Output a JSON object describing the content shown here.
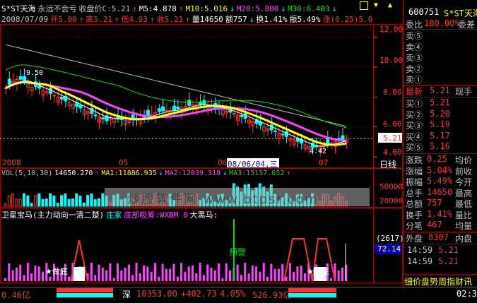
{
  "colors": {
    "up": "#ff3030",
    "down": "#00ffff",
    "ma5": "#ffffff",
    "ma10": "#ffff00",
    "ma20": "#ff40ff",
    "ma30": "#00e000",
    "bg": "#000000",
    "grid": "#a00000"
  },
  "header": {
    "row1": [
      {
        "t": "S*ST天海",
        "c": "wht"
      },
      {
        "t": "永远不会亏",
        "c": "gry"
      },
      {
        "t": "收盘价C:5.21",
        "c": "gry"
      },
      {
        "t": "↑",
        "c": "red"
      },
      {
        "t": "M5:4.878",
        "c": "wht"
      },
      {
        "t": "↑",
        "c": "red"
      },
      {
        "t": "M10:5.016",
        "c": "yel"
      },
      {
        "t": "↓",
        "c": "cyn"
      },
      {
        "t": "M20:5.800",
        "c": "mag"
      },
      {
        "t": "↓",
        "c": "cyn"
      },
      {
        "t": "M30:6.403",
        "c": "grn"
      },
      {
        "t": "↓",
        "c": "cyn"
      }
    ],
    "row2": [
      {
        "t": "2008/07/09",
        "c": "gry"
      },
      {
        "t": "开5.00",
        "c": "red"
      },
      {
        "t": "↑",
        "c": "red"
      },
      {
        "t": "高5.21",
        "c": "red"
      },
      {
        "t": "↑",
        "c": "red"
      },
      {
        "t": "低4.93",
        "c": "red"
      },
      {
        "t": "↑",
        "c": "red"
      },
      {
        "t": "收5.21",
        "c": "red"
      },
      {
        "t": "↑",
        "c": "red"
      },
      {
        "t": "量14650",
        "c": "wht"
      },
      {
        "t": "额757",
        "c": "wht"
      },
      {
        "t": "↓",
        "c": "cyn"
      },
      {
        "t": "换1.41%",
        "c": "wht"
      },
      {
        "t": "振5.49%",
        "c": "wht"
      },
      {
        "t": "涨(0.25)5.0",
        "c": "red"
      }
    ]
  },
  "price_axis": [
    "12.00",
    "10.00",
    "8.00",
    "6.00",
    "5.21",
    "4.00"
  ],
  "price_marks": {
    "hi": "9.50",
    "lo": "4.42"
  },
  "date_axis": [
    "2008",
    "05",
    "06",
    "08/06/04,三",
    "07",
    "日线"
  ],
  "volume_header": [
    {
      "t": "VOL(5,10,30)",
      "c": "gry"
    },
    {
      "t": "14650.270",
      "c": "wht"
    },
    {
      "t": "↑",
      "c": "red"
    },
    {
      "t": "MA1:11886.935",
      "c": "yel"
    },
    {
      "t": "↓",
      "c": "cyn"
    },
    {
      "t": "MA2:12039.318",
      "c": "mag"
    },
    {
      "t": "↓",
      "c": "cyn"
    },
    {
      "t": "MA3:15157.652",
      "c": "grn"
    },
    {
      "t": "↑",
      "c": "red"
    }
  ],
  "volume_axis": [
    "50000",
    "20000"
  ],
  "watermark": "炒股软件网 www.btpsr.com",
  "indicator_header": [
    {
      "t": "卫星宝马(主力动向一清二楚)",
      "c": "wht"
    },
    {
      "t": "庄家",
      "c": "cyn"
    },
    {
      "t": "底部吸筹:WXBM 0",
      "c": "mag"
    },
    {
      "t": "大黑马:",
      "c": "wht"
    }
  ],
  "indicator_axis": {
    "a": "(2617)",
    "b": "72.14"
  },
  "indicator_labels": {
    "warn": "预警",
    "bottom1": "★做底",
    "bottom2": "★做底"
  },
  "stock": {
    "code": "600751",
    "name": "S*ST天海"
  },
  "orderbook": {
    "ratio_label": "委比",
    "ratio": "100.00%",
    "diff_label": "委差",
    "asks": [
      {
        "l": "卖⑤",
        "p": ""
      },
      {
        "l": "卖④",
        "p": ""
      },
      {
        "l": "卖③",
        "p": ""
      },
      {
        "l": "卖②",
        "p": ""
      },
      {
        "l": "卖①",
        "p": ""
      }
    ],
    "last_label": "最新",
    "last": "5.21",
    "hand_label": "现手",
    "bids": [
      {
        "l": "买①",
        "p": "5.21"
      },
      {
        "l": "买②",
        "p": "5.20"
      },
      {
        "l": "买③",
        "p": "5.19"
      },
      {
        "l": "买④",
        "p": "5.17"
      },
      {
        "l": "买⑤",
        "p": "5.16"
      }
    ]
  },
  "quote": [
    {
      "l1": "涨跌",
      "v1": "0.25",
      "l2": "均价"
    },
    {
      "l1": "涨幅",
      "v1": "5.04%",
      "l2": "前收"
    },
    {
      "l1": "振幅",
      "v1": "5.49%",
      "l2": "今开"
    },
    {
      "l1": "总手",
      "v1": "14650",
      "l2": "最高"
    },
    {
      "l1": "总额",
      "v1": "757",
      "l2": "最低"
    },
    {
      "l1": "换手",
      "v1": "1.41%",
      "l2": "量比"
    },
    {
      "l1": "分笔",
      "v1": "467",
      "l2": "均量"
    }
  ],
  "outer": {
    "l": "外盘",
    "v": "8307",
    "r": "内盘"
  },
  "ticks": [
    {
      "t": "14:59",
      "p": "5.21"
    },
    {
      "t": "14:59",
      "p": "5.21"
    }
  ],
  "tabs": "细价盘势周指财讯",
  "status": {
    "left": "0.46亿",
    "market": "深",
    "index": "10353.00",
    "change": "+402.73",
    "pct": "4.05%",
    "amount": "526.93亿",
    "time": "02:35"
  },
  "chart_data": {
    "type": "candlestick",
    "x": [
      "2008",
      "05",
      "06",
      "07"
    ],
    "ylim": [
      4,
      12.6
    ],
    "close_last": 5.21,
    "high_mark": 9.5,
    "low_mark": 4.42,
    "ma": {
      "M5": 4.878,
      "M10": 5.016,
      "M20": 5.8,
      "M30": 6.403
    },
    "volume": {
      "VOL": 14650.27,
      "MA1": 11886.935,
      "MA2": 12039.318,
      "MA3": 15157.652
    }
  }
}
